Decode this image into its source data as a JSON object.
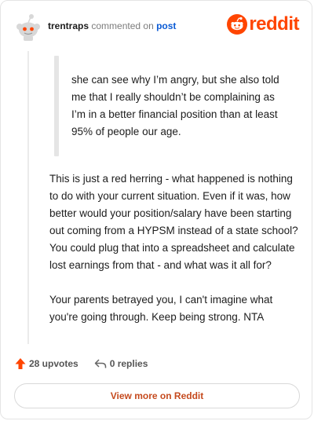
{
  "header": {
    "username": "trentraps",
    "action_text": "commented on",
    "post_link": "post",
    "logo_text": "reddit",
    "brand_color": "#ff4500"
  },
  "comment": {
    "quote": "she can see why I’m angry, but she also told me that I really shouldn’t be complaining as I’m in a better financial position than at least 95% of people our age.",
    "paragraphs": [
      "This is just a red herring - what happened is nothing to do with your current situation. Even if it was, how better would your position/salary have been starting out coming from a HYPSM instead of a state school? You could plug that into a spreadsheet and calculate lost earnings from that - and what was it all for?",
      "Your parents betrayed you, I can't imagine what you're going through. Keep being strong. NTA"
    ]
  },
  "actions": {
    "upvotes_label": "28 upvotes",
    "replies_label": "0 replies",
    "upvote_icon": "upvote-arrow-icon",
    "reply_icon": "reply-arrow-icon"
  },
  "footer": {
    "view_more_label": "View more on Reddit"
  }
}
